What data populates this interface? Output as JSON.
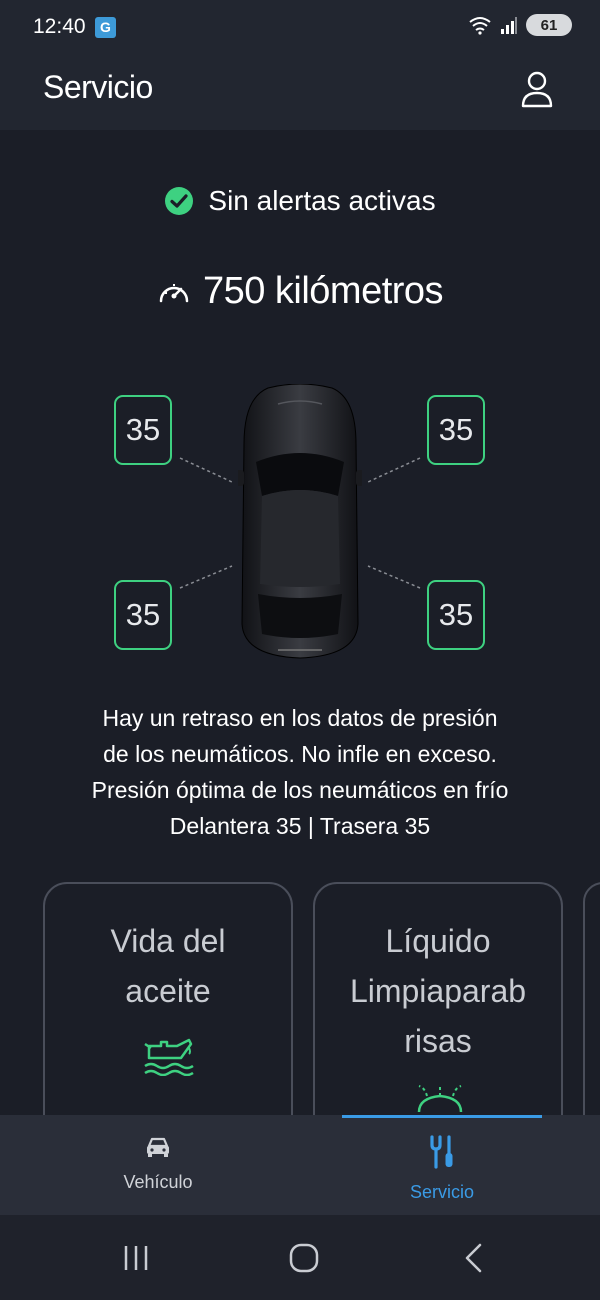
{
  "status_bar": {
    "time": "12:40",
    "app_badge": "G",
    "battery": "61"
  },
  "header": {
    "title": "Servicio",
    "profile_icon": "person-icon"
  },
  "alert": {
    "icon": "check-circle-icon",
    "text": "Sin alertas activas",
    "color": "#3ed181"
  },
  "odometer": {
    "icon": "speedometer-icon",
    "text": "750 kilómetros"
  },
  "tires": {
    "front_left": "35",
    "front_right": "35",
    "rear_left": "35",
    "rear_right": "35",
    "border_color": "#3ed181"
  },
  "info_lines": [
    "Hay un retraso en los datos de presión",
    "de los neumáticos. No infle en exceso.",
    "Presión óptima de los neumáticos en frío",
    "Delantera 35 | Trasera 35"
  ],
  "cards": [
    {
      "line1": "Vida del",
      "line2": "aceite",
      "line3": "",
      "icon": "oil-can-icon"
    },
    {
      "line1": "Líquido",
      "line2": "Limpiaparab",
      "line3": "risas",
      "icon": "washer-fluid-icon"
    }
  ],
  "bottom_nav": {
    "items": [
      {
        "label": "Vehículo",
        "icon": "car-icon",
        "active": false
      },
      {
        "label": "Servicio",
        "icon": "tools-icon",
        "active": true
      }
    ],
    "active_color": "#3a9be6"
  },
  "system_nav": {
    "recent": "recent-apps-icon",
    "home": "home-icon",
    "back": "back-icon"
  }
}
